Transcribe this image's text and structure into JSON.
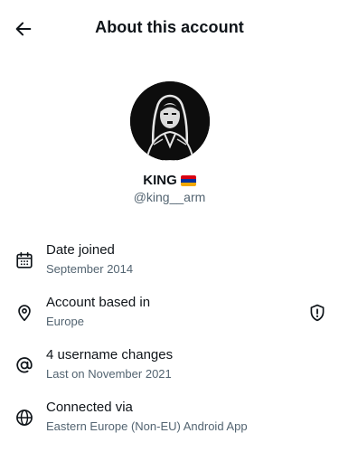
{
  "header": {
    "title": "About this account",
    "back_icon": "arrow-left-icon"
  },
  "profile": {
    "display_name": "KING",
    "flag": "Armenia flag",
    "flag_colors": [
      "#d90012",
      "#0033a0",
      "#f2a800"
    ],
    "handle": "@king__arm"
  },
  "details": [
    {
      "icon": "calendar-icon",
      "label": "Date joined",
      "value": "September 2014"
    },
    {
      "icon": "location-pin-icon",
      "label": "Account based in",
      "value": "Europe",
      "badge_icon": "shield-icon"
    },
    {
      "icon": "at-sign-icon",
      "label": "4 username changes",
      "value": "Last on November 2021"
    },
    {
      "icon": "globe-icon",
      "label": "Connected via",
      "value": "Eastern Europe (Non-EU) Android App"
    }
  ],
  "colors": {
    "text_primary": "#0f1419",
    "text_secondary": "#536471",
    "background": "#ffffff"
  }
}
